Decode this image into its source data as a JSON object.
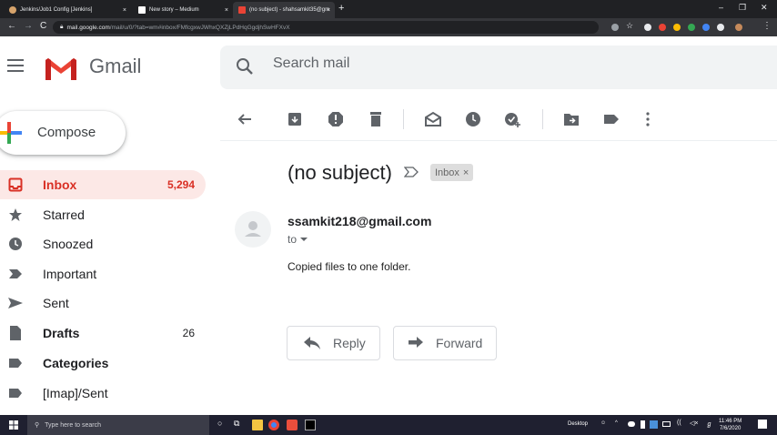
{
  "browser": {
    "tabs": [
      {
        "label": "Jenkins/Job1 Config [Jenkins]",
        "favicon_color": "#d6a36b"
      },
      {
        "label": "New story – Medium",
        "favicon_color": "#ffffff"
      },
      {
        "label": "(no subject) - shahsamkit35@gm",
        "favicon_color": "#ea4335"
      }
    ],
    "tab_close": "×",
    "new_tab": "+",
    "url_host": "mail.google.com",
    "url_path": "/mail/u/0/?tab=wm#inbox/FMfcgxwJWhxQXZjLPdHqGgdjhSwHFXvX"
  },
  "app": {
    "name": "Gmail",
    "search_placeholder": "Search mail",
    "compose_label": "Compose"
  },
  "sidebar": {
    "items": [
      {
        "label": "Inbox",
        "count": "5,294",
        "icon": "inbox-icon",
        "active": true
      },
      {
        "label": "Starred",
        "count": "",
        "icon": "star-icon"
      },
      {
        "label": "Snoozed",
        "count": "",
        "icon": "clock-icon"
      },
      {
        "label": "Important",
        "count": "",
        "icon": "important-icon"
      },
      {
        "label": "Sent",
        "count": "",
        "icon": "send-icon"
      },
      {
        "label": "Drafts",
        "count": "26",
        "icon": "draft-icon",
        "bold": true
      },
      {
        "label": "Categories",
        "count": "",
        "icon": "label-icon",
        "bold": true
      },
      {
        "label": "[Imap]/Sent",
        "count": "",
        "icon": "label-icon"
      }
    ]
  },
  "toolbar": {
    "icons": [
      "back-icon",
      "archive-icon",
      "report-spam-icon",
      "delete-icon",
      "mark-unread-icon",
      "snooze-icon",
      "add-to-tasks-icon",
      "move-to-icon",
      "labels-icon",
      "more-icon"
    ]
  },
  "message": {
    "subject": "(no subject)",
    "label": "Inbox",
    "label_remove": "×",
    "sender": "ssamkit218@gmail.com",
    "to": "to",
    "body": "Copied files to one folder.",
    "reply_label": "Reply",
    "forward_label": "Forward"
  },
  "taskbar": {
    "search_placeholder": "Type here to search",
    "desktop_label": "Desktop",
    "time": "11:46 PM",
    "date": "7/6/2020"
  },
  "colors": {
    "gmail_red": "#d93025",
    "inbox_active_bg": "#fce8e6",
    "chrome_dark": "#202124",
    "taskbar": "#1f2030"
  }
}
